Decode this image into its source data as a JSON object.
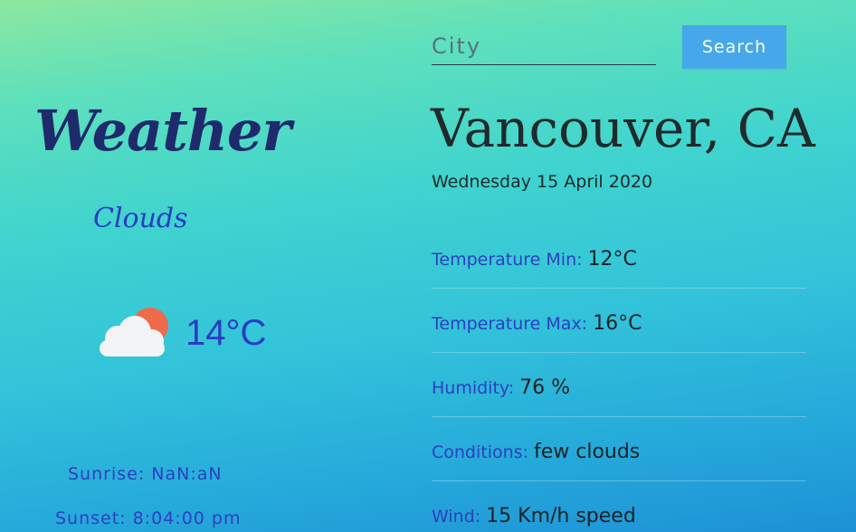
{
  "logo": "Weather",
  "summary": {
    "condition": "Clouds",
    "temperature": "14°C",
    "icon": "partly-cloudy-icon",
    "sunrise": "Sunrise: NaN:aN",
    "sunset": "Sunset: 8:04:00 pm"
  },
  "search": {
    "placeholder": "City",
    "value": "",
    "button_label": "Search"
  },
  "location": {
    "city": "Vancouver, CA",
    "date": "Wednesday 15 April 2020"
  },
  "details": [
    {
      "label": "Temperature Min:",
      "value": "12°C"
    },
    {
      "label": "Temperature Max:",
      "value": "16°C"
    },
    {
      "label": "Humidity:",
      "value": "76 %"
    },
    {
      "label": "Conditions:",
      "value": "few clouds"
    },
    {
      "label": "Wind:",
      "value": "15 Km/h speed"
    }
  ],
  "colors": {
    "accent": "#46a8ea",
    "label": "#2d3fc0",
    "logo": "#1e2a6b",
    "sun": "#ee6a4a"
  }
}
